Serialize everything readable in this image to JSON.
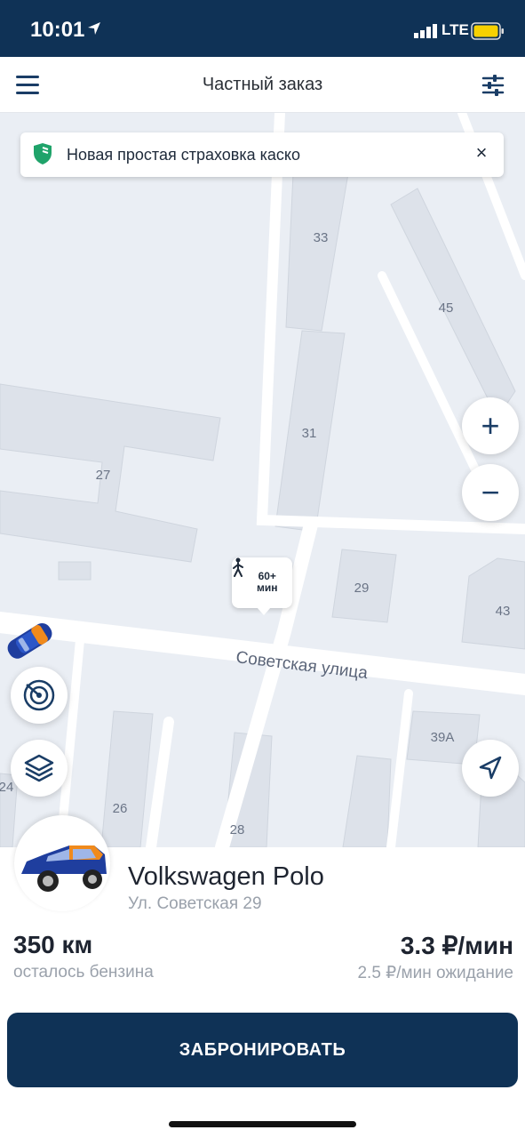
{
  "status_bar": {
    "time": "10:01",
    "network": "LTE"
  },
  "header": {
    "title": "Частный заказ"
  },
  "banner": {
    "text": "Новая простая страховка каско",
    "close": "×"
  },
  "map": {
    "buildings": [
      "33",
      "45",
      "31",
      "27",
      "29",
      "43",
      "39А",
      "26",
      "28",
      "24"
    ],
    "street": "Советская улица",
    "walk_time_value": "60+",
    "walk_time_unit": "мин",
    "zoom_in": "+",
    "zoom_out": "−"
  },
  "car": {
    "model": "Volkswagen Polo",
    "address": "Ул. Советская 29",
    "fuel_value": "350 км",
    "fuel_label": "осталось бензина",
    "price": "3.3 ₽/мин",
    "wait_price": "2.5 ₽/мин ожидание"
  },
  "actions": {
    "book": "ЗАБРОНИРОВАТЬ"
  },
  "colors": {
    "brand_navy": "#0f3256",
    "map_bg": "#eaeef4",
    "building": "#dde2ea",
    "road": "#ffffff",
    "accent_orange": "#f08a1c"
  },
  "icons": [
    "menu-icon",
    "filter-icon",
    "shield-icon",
    "close-icon",
    "plus-icon",
    "minus-icon",
    "radar-icon",
    "layers-icon",
    "navigation-arrow-icon",
    "walking-person-icon",
    "car-icon"
  ]
}
